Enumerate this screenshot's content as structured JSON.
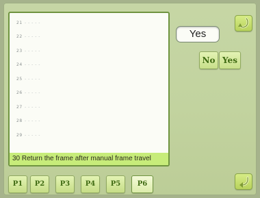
{
  "list": {
    "items": [
      {
        "num": "21",
        "dots": "- - - - -"
      },
      {
        "num": "22",
        "dots": "- - - - -"
      },
      {
        "num": "23",
        "dots": "- - - - -"
      },
      {
        "num": "24",
        "dots": "- - - - -"
      },
      {
        "num": "25",
        "dots": "- - - - -"
      },
      {
        "num": "26",
        "dots": "- - - - -"
      },
      {
        "num": "27",
        "dots": "- - - - -"
      },
      {
        "num": "28",
        "dots": "- - - - -"
      },
      {
        "num": "29",
        "dots": "- - - - -"
      }
    ],
    "selected": "30 Return the frame after manual frame travel"
  },
  "value_display": "Yes",
  "choices": {
    "no": "No",
    "yes": "Yes"
  },
  "pages": [
    "P1",
    "P2",
    "P3",
    "P4",
    "P5",
    "P6"
  ],
  "active_page": "P6",
  "colors": {
    "background": "#c2d39f",
    "highlight": "#c7ec7a",
    "panel_border": "#6f9440",
    "button_text": "#3f6a12",
    "corner_button": "#c6df70"
  },
  "icons": {
    "top_corner": "return-arrow-icon",
    "bottom_corner": "back-arrow-icon"
  }
}
